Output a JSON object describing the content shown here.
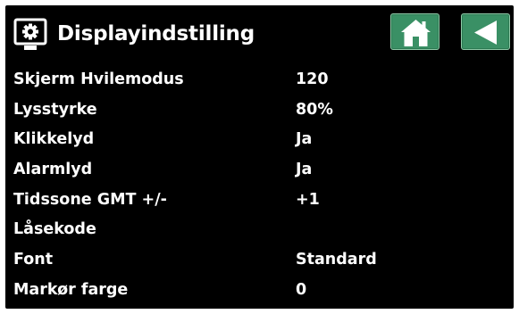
{
  "header": {
    "title": "Displayindstilling",
    "title_icon": "display-settings-icon",
    "home_icon": "home-icon",
    "back_icon": "back-arrow-icon"
  },
  "settings": [
    {
      "label": "Skjerm Hvilemodus",
      "value": "120"
    },
    {
      "label": "Lysstyrke",
      "value": "80%"
    },
    {
      "label": "Klikkelyd",
      "value": "Ja"
    },
    {
      "label": "Alarmlyd",
      "value": "Ja"
    },
    {
      "label": "Tidssone GMT +/-",
      "value": "+1"
    },
    {
      "label": "Låsekode",
      "value": ""
    },
    {
      "label": "Font",
      "value": "Standard"
    },
    {
      "label": "Markør farge",
      "value": "0"
    }
  ],
  "colors": {
    "background": "#000000",
    "text": "#ffffff",
    "button": "#3a9065"
  }
}
